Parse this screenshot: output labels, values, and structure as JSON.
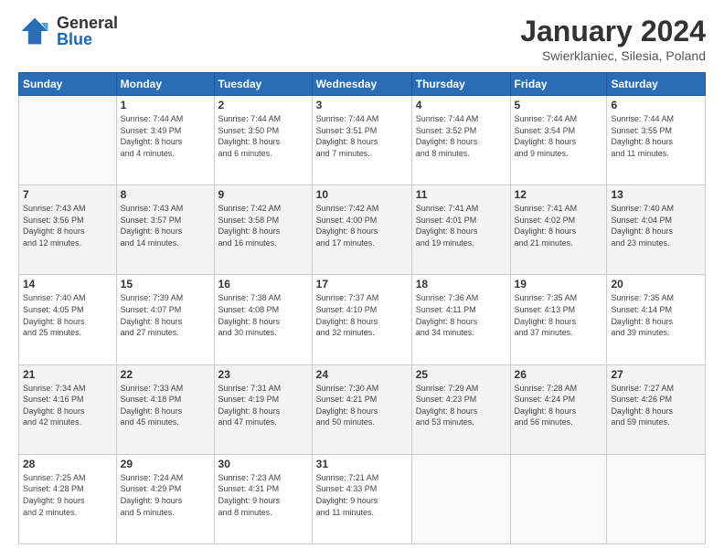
{
  "logo": {
    "general": "General",
    "blue": "Blue"
  },
  "header": {
    "month": "January 2024",
    "location": "Swierklaniec, Silesia, Poland"
  },
  "weekdays": [
    "Sunday",
    "Monday",
    "Tuesday",
    "Wednesday",
    "Thursday",
    "Friday",
    "Saturday"
  ],
  "weeks": [
    {
      "shade": "white",
      "days": [
        {
          "num": "",
          "info": ""
        },
        {
          "num": "1",
          "info": "Sunrise: 7:44 AM\nSunset: 3:49 PM\nDaylight: 8 hours\nand 4 minutes."
        },
        {
          "num": "2",
          "info": "Sunrise: 7:44 AM\nSunset: 3:50 PM\nDaylight: 8 hours\nand 6 minutes."
        },
        {
          "num": "3",
          "info": "Sunrise: 7:44 AM\nSunset: 3:51 PM\nDaylight: 8 hours\nand 7 minutes."
        },
        {
          "num": "4",
          "info": "Sunrise: 7:44 AM\nSunset: 3:52 PM\nDaylight: 8 hours\nand 8 minutes."
        },
        {
          "num": "5",
          "info": "Sunrise: 7:44 AM\nSunset: 3:54 PM\nDaylight: 8 hours\nand 9 minutes."
        },
        {
          "num": "6",
          "info": "Sunrise: 7:44 AM\nSunset: 3:55 PM\nDaylight: 8 hours\nand 11 minutes."
        }
      ]
    },
    {
      "shade": "shaded",
      "days": [
        {
          "num": "7",
          "info": "Sunrise: 7:43 AM\nSunset: 3:56 PM\nDaylight: 8 hours\nand 12 minutes."
        },
        {
          "num": "8",
          "info": "Sunrise: 7:43 AM\nSunset: 3:57 PM\nDaylight: 8 hours\nand 14 minutes."
        },
        {
          "num": "9",
          "info": "Sunrise: 7:42 AM\nSunset: 3:58 PM\nDaylight: 8 hours\nand 16 minutes."
        },
        {
          "num": "10",
          "info": "Sunrise: 7:42 AM\nSunset: 4:00 PM\nDaylight: 8 hours\nand 17 minutes."
        },
        {
          "num": "11",
          "info": "Sunrise: 7:41 AM\nSunset: 4:01 PM\nDaylight: 8 hours\nand 19 minutes."
        },
        {
          "num": "12",
          "info": "Sunrise: 7:41 AM\nSunset: 4:02 PM\nDaylight: 8 hours\nand 21 minutes."
        },
        {
          "num": "13",
          "info": "Sunrise: 7:40 AM\nSunset: 4:04 PM\nDaylight: 8 hours\nand 23 minutes."
        }
      ]
    },
    {
      "shade": "white",
      "days": [
        {
          "num": "14",
          "info": "Sunrise: 7:40 AM\nSunset: 4:05 PM\nDaylight: 8 hours\nand 25 minutes."
        },
        {
          "num": "15",
          "info": "Sunrise: 7:39 AM\nSunset: 4:07 PM\nDaylight: 8 hours\nand 27 minutes."
        },
        {
          "num": "16",
          "info": "Sunrise: 7:38 AM\nSunset: 4:08 PM\nDaylight: 8 hours\nand 30 minutes."
        },
        {
          "num": "17",
          "info": "Sunrise: 7:37 AM\nSunset: 4:10 PM\nDaylight: 8 hours\nand 32 minutes."
        },
        {
          "num": "18",
          "info": "Sunrise: 7:36 AM\nSunset: 4:11 PM\nDaylight: 8 hours\nand 34 minutes."
        },
        {
          "num": "19",
          "info": "Sunrise: 7:35 AM\nSunset: 4:13 PM\nDaylight: 8 hours\nand 37 minutes."
        },
        {
          "num": "20",
          "info": "Sunrise: 7:35 AM\nSunset: 4:14 PM\nDaylight: 8 hours\nand 39 minutes."
        }
      ]
    },
    {
      "shade": "shaded",
      "days": [
        {
          "num": "21",
          "info": "Sunrise: 7:34 AM\nSunset: 4:16 PM\nDaylight: 8 hours\nand 42 minutes."
        },
        {
          "num": "22",
          "info": "Sunrise: 7:33 AM\nSunset: 4:18 PM\nDaylight: 8 hours\nand 45 minutes."
        },
        {
          "num": "23",
          "info": "Sunrise: 7:31 AM\nSunset: 4:19 PM\nDaylight: 8 hours\nand 47 minutes."
        },
        {
          "num": "24",
          "info": "Sunrise: 7:30 AM\nSunset: 4:21 PM\nDaylight: 8 hours\nand 50 minutes."
        },
        {
          "num": "25",
          "info": "Sunrise: 7:29 AM\nSunset: 4:23 PM\nDaylight: 8 hours\nand 53 minutes."
        },
        {
          "num": "26",
          "info": "Sunrise: 7:28 AM\nSunset: 4:24 PM\nDaylight: 8 hours\nand 56 minutes."
        },
        {
          "num": "27",
          "info": "Sunrise: 7:27 AM\nSunset: 4:26 PM\nDaylight: 8 hours\nand 59 minutes."
        }
      ]
    },
    {
      "shade": "white",
      "days": [
        {
          "num": "28",
          "info": "Sunrise: 7:25 AM\nSunset: 4:28 PM\nDaylight: 9 hours\nand 2 minutes."
        },
        {
          "num": "29",
          "info": "Sunrise: 7:24 AM\nSunset: 4:29 PM\nDaylight: 9 hours\nand 5 minutes."
        },
        {
          "num": "30",
          "info": "Sunrise: 7:23 AM\nSunset: 4:31 PM\nDaylight: 9 hours\nand 8 minutes."
        },
        {
          "num": "31",
          "info": "Sunrise: 7:21 AM\nSunset: 4:33 PM\nDaylight: 9 hours\nand 11 minutes."
        },
        {
          "num": "",
          "info": ""
        },
        {
          "num": "",
          "info": ""
        },
        {
          "num": "",
          "info": ""
        }
      ]
    }
  ]
}
